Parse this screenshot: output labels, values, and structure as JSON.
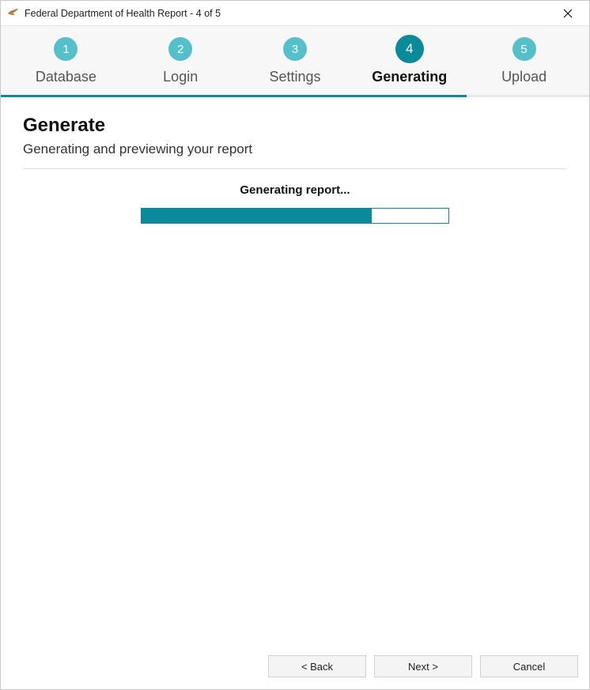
{
  "window": {
    "title": "Federal Department of Health Report - 4 of 5"
  },
  "steps": [
    {
      "num": "1",
      "label": "Database",
      "active": false
    },
    {
      "num": "2",
      "label": "Login",
      "active": false
    },
    {
      "num": "3",
      "label": "Settings",
      "active": false
    },
    {
      "num": "4",
      "label": "Generating",
      "active": true
    },
    {
      "num": "5",
      "label": "Upload",
      "active": false
    }
  ],
  "active_step_index": 3,
  "page": {
    "heading": "Generate",
    "subtitle": "Generating and previewing your report",
    "status": "Generating report...",
    "progress_percent": 75
  },
  "buttons": {
    "back": "< Back",
    "next": "Next >",
    "cancel": "Cancel"
  },
  "theme": {
    "accent": "#0b8b9a",
    "accent_light": "#54c0ca"
  }
}
